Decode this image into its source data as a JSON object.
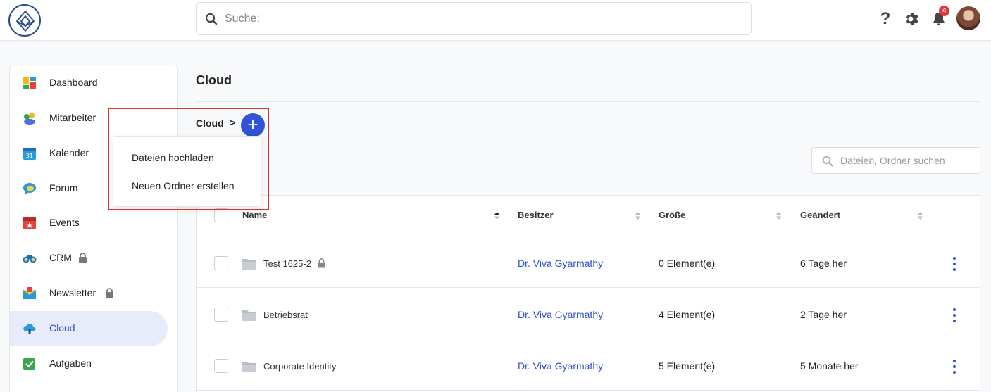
{
  "header": {
    "search_placeholder": "Suche:",
    "help_label": "?",
    "notification_count": "4"
  },
  "sidebar": {
    "items": [
      {
        "label": "Dashboard",
        "icon": "dashboard-icon",
        "locked": false,
        "active": false
      },
      {
        "label": "Mitarbeiter",
        "icon": "users-icon",
        "locked": false,
        "active": false
      },
      {
        "label": "Kalender",
        "icon": "calendar-icon",
        "locked": false,
        "active": false
      },
      {
        "label": "Forum",
        "icon": "chat-icon",
        "locked": false,
        "active": false
      },
      {
        "label": "Events",
        "icon": "event-icon",
        "locked": false,
        "active": false
      },
      {
        "label": "CRM",
        "icon": "binoculars-icon",
        "locked": true,
        "active": false
      },
      {
        "label": "Newsletter",
        "icon": "envelope-icon",
        "locked": true,
        "active": false
      },
      {
        "label": "Cloud",
        "icon": "cloud-icon",
        "locked": false,
        "active": true
      },
      {
        "label": "Aufgaben",
        "icon": "checklist-icon",
        "locked": false,
        "active": false
      }
    ]
  },
  "main": {
    "title": "Cloud",
    "breadcrumb": "Cloud",
    "breadcrumb_separator": ">",
    "add_label": "+",
    "dropdown": [
      "Dateien hochladen",
      "Neuen Ordner erstellen"
    ],
    "filter_placeholder": "Dateien, Ordner suchen",
    "table": {
      "columns": [
        "Name",
        "Besitzer",
        "Größe",
        "Geändert"
      ],
      "rows": [
        {
          "name": "Test 1625-2",
          "locked": true,
          "owner": "Dr. Viva Gyarmathy",
          "size": "0 Element(e)",
          "changed": "6 Tage her"
        },
        {
          "name": "Betriebsrat",
          "locked": false,
          "owner": "Dr. Viva Gyarmathy",
          "size": "4 Element(e)",
          "changed": "2 Tage her"
        },
        {
          "name": "Corporate Identity",
          "locked": false,
          "owner": "Dr. Viva Gyarmathy",
          "size": "5 Element(e)",
          "changed": "5 Monate her"
        }
      ]
    }
  },
  "colors": {
    "accent": "#2f54d6",
    "highlight": "#e0342a",
    "active_bg": "#e8ecfa"
  }
}
